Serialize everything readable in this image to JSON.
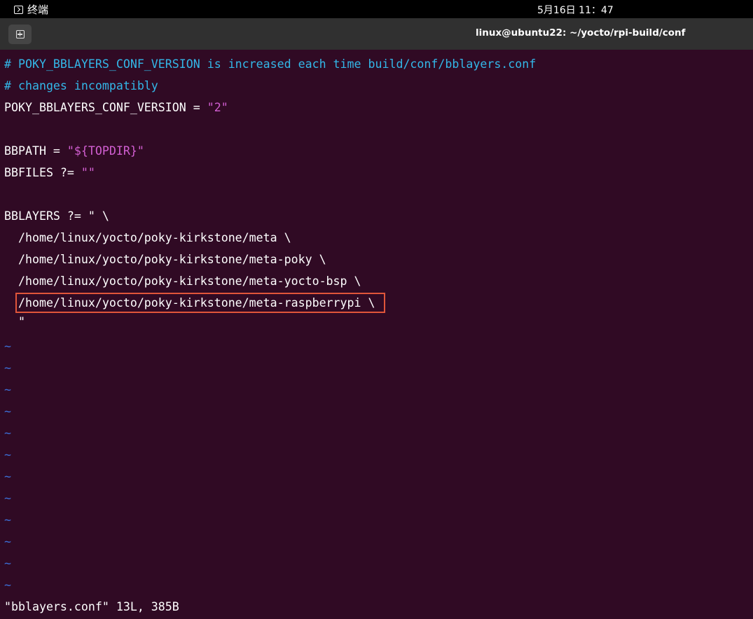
{
  "topbar": {
    "app_name": "终端",
    "app_icon": "terminal-icon",
    "clock": "5月16日  11：47"
  },
  "titlebar": {
    "new_tab_icon": "new-tab-icon",
    "title": "linux@ubuntu22: ~/yocto/rpi-build/conf"
  },
  "editor": {
    "comment1": "# POKY_BBLAYERS_CONF_VERSION is increased each time build/conf/bblayers.conf",
    "comment2": "# changes incompatibly",
    "version_key": "POKY_BBLAYERS_CONF_VERSION = ",
    "version_val": "\"2\"",
    "bbpath_key": "BBPATH = ",
    "bbpath_q1": "\"",
    "bbpath_var": "${TOPDIR}",
    "bbpath_q2": "\"",
    "bbfiles_key": "BBFILES ?= ",
    "bbfiles_val": "\"\"",
    "bblayers_key": "BBLAYERS ?= \" \\",
    "layers": [
      "  /home/linux/yocto/poky-kirkstone/meta \\",
      "  /home/linux/yocto/poky-kirkstone/meta-poky \\",
      "  /home/linux/yocto/poky-kirkstone/meta-yocto-bsp \\",
      "  /home/linux/yocto/poky-kirkstone/meta-raspberrypi \\"
    ],
    "closing_quote": "  \"",
    "tilde": "~"
  },
  "status_line": "\"bblayers.conf\" 13L, 385B",
  "colors": {
    "background": "#300a24",
    "comment": "#33b7e8",
    "string": "#d25fd2",
    "tilde": "#3c6fd8",
    "highlight": "#e0553a"
  }
}
